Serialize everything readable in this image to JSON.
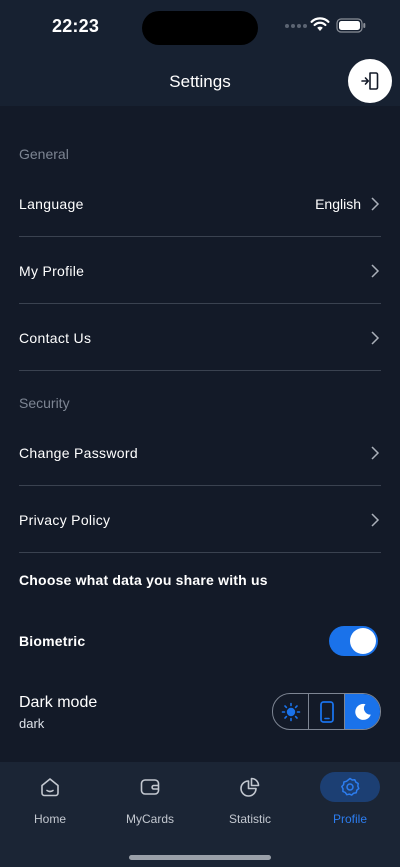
{
  "status_bar": {
    "time": "22:23"
  },
  "header": {
    "title": "Settings",
    "action_icon": "logout-icon"
  },
  "sections": {
    "general": "General",
    "security": "Security"
  },
  "rows": {
    "language": {
      "label": "Language",
      "value": "English"
    },
    "my_profile": {
      "label": "My Profile"
    },
    "contact_us": {
      "label": "Contact Us"
    },
    "change_password": {
      "label": "Change Password"
    },
    "privacy_policy": {
      "label": "Privacy Policy"
    }
  },
  "data_share": {
    "title": "Choose what data you share with us",
    "biometric_label": "Biometric",
    "biometric_on": true
  },
  "dark_mode": {
    "label": "Dark mode",
    "value": "dark",
    "options": [
      "light",
      "system",
      "dark"
    ],
    "selected": "dark"
  },
  "tabs": [
    {
      "label": "Home",
      "icon": "home-icon"
    },
    {
      "label": "MyCards",
      "icon": "wallet-icon"
    },
    {
      "label": "Statistic",
      "icon": "pie-chart-icon"
    },
    {
      "label": "Profile",
      "icon": "gear-icon",
      "active": true
    }
  ],
  "colors": {
    "accent": "#1a72ea",
    "background": "#131a28",
    "tabbar": "#1b2535"
  }
}
